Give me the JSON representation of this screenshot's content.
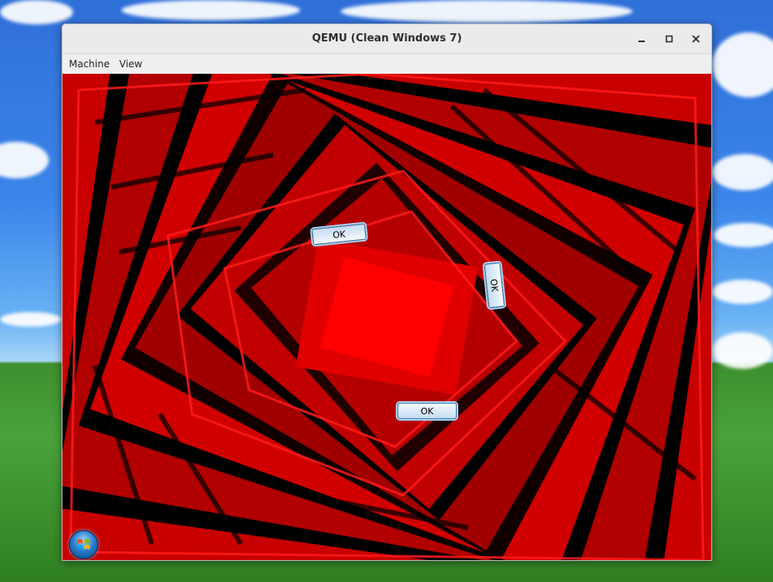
{
  "window": {
    "title": "QEMU (Clean Windows 7)",
    "controls": {
      "minimize": "minimize-icon",
      "maximize": "maximize-icon",
      "close": "close-icon"
    }
  },
  "menu": {
    "items": [
      {
        "label": "Machine"
      },
      {
        "label": "View"
      }
    ]
  },
  "guest": {
    "buttons": [
      {
        "label": "OK"
      },
      {
        "label": "OK"
      },
      {
        "label": "OK"
      }
    ],
    "start_icon": "windows-start-orb-icon"
  },
  "colors": {
    "glitch_red": "#e00000",
    "dark_red": "#6a0000",
    "black": "#000000"
  }
}
